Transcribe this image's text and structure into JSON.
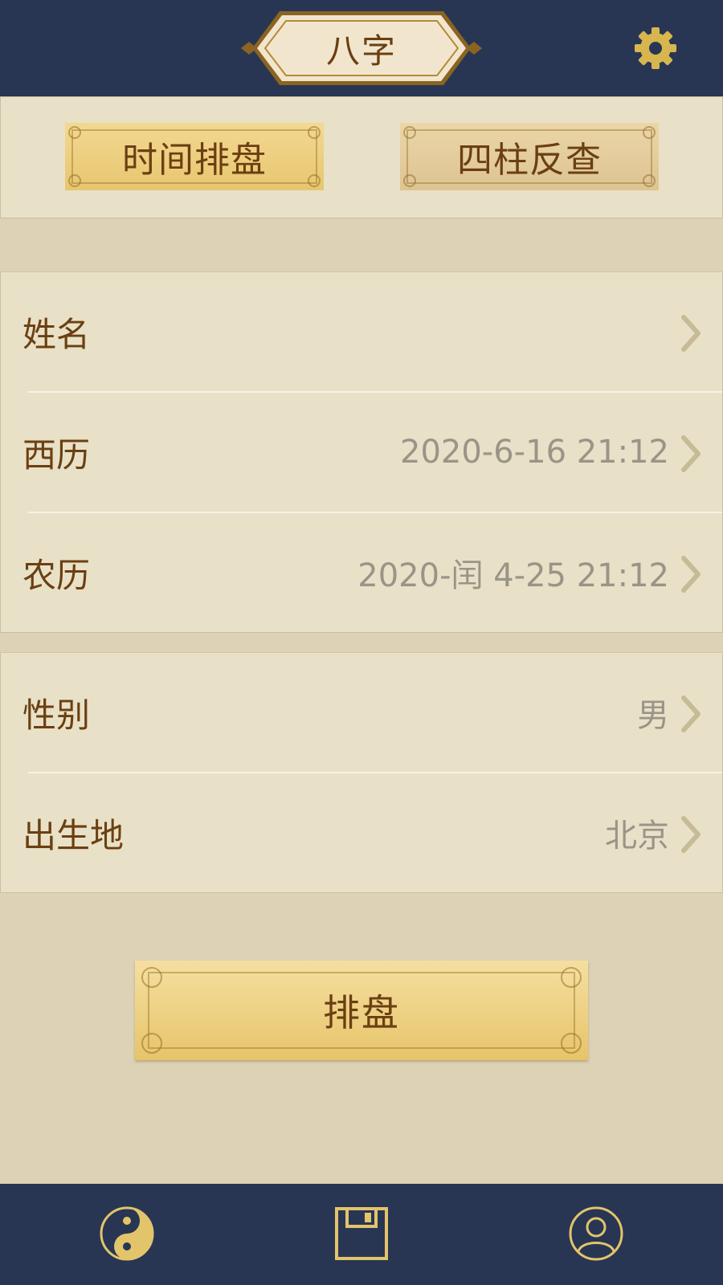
{
  "header": {
    "title": "八字",
    "settings_icon": "gear-icon"
  },
  "mode_tabs": {
    "active": {
      "label": "时间排盘"
    },
    "inactive": {
      "label": "四柱反查"
    }
  },
  "form": {
    "group1": [
      {
        "label": "姓名",
        "value": ""
      },
      {
        "label": "西历",
        "value": "2020-6-16 21:12"
      },
      {
        "label": "农历",
        "value": "2020-闰 4-25 21:12"
      }
    ],
    "group2": [
      {
        "label": "性别",
        "value": "男"
      },
      {
        "label": "出生地",
        "value": "北京"
      }
    ]
  },
  "action_button": {
    "label": "排盘"
  },
  "tabbar": {
    "items": [
      {
        "icon": "yin-yang-icon"
      },
      {
        "icon": "save-icon"
      },
      {
        "icon": "profile-icon"
      }
    ]
  },
  "colors": {
    "navy": "#283654",
    "gold": "#d8b64f",
    "brown_text": "#6b3f12",
    "panel": "#e8e1c7",
    "background": "#ddd2b6",
    "value_gray": "#9a9488"
  }
}
